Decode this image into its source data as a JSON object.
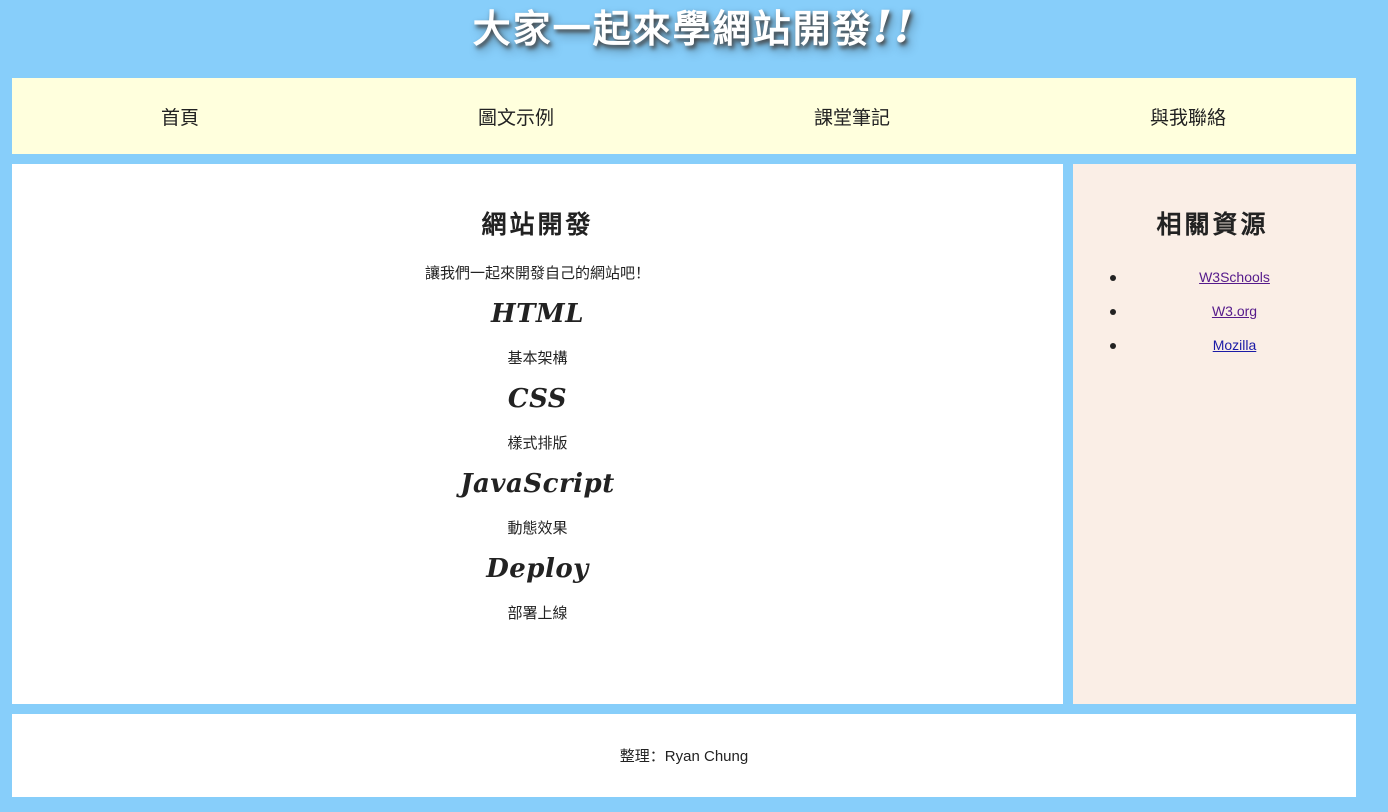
{
  "header": {
    "title": "大家一起來學網站開發",
    "title_suffix": "!!"
  },
  "nav": {
    "items": [
      "首頁",
      "圖文示例",
      "課堂筆記",
      "與我聯絡"
    ]
  },
  "main": {
    "heading": "網站開發",
    "intro": "讓我們一起來開發自己的網站吧！",
    "topics": [
      {
        "name": "HTML",
        "desc": "基本架構"
      },
      {
        "name": "CSS",
        "desc": "樣式排版"
      },
      {
        "name": "JavaScript",
        "desc": "動態效果"
      },
      {
        "name": "Deploy",
        "desc": "部署上線"
      }
    ]
  },
  "aside": {
    "heading": "相關資源",
    "links": [
      "W3Schools",
      "W3.org",
      "Mozilla"
    ]
  },
  "footer": {
    "credit": "整理：Ryan Chung"
  },
  "colors": {
    "page_background": "#87cefa",
    "nav_background": "#ffffdd",
    "aside_background": "#faeee6",
    "visited_link": "#551a8b",
    "link": "#1a1aa6"
  }
}
